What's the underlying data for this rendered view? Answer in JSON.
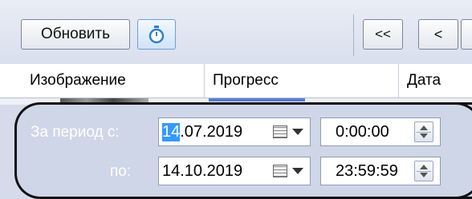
{
  "toolbar": {
    "refresh_label": "Обновить",
    "timer_icon": "stopwatch-icon",
    "first_label": "<<",
    "prev_label": "<"
  },
  "grid": {
    "columns": [
      "Изображение",
      "Прогресс",
      "Дата"
    ]
  },
  "period": {
    "from_label": "За период с:",
    "to_label": "по:",
    "from_date_selected": "14",
    "from_date_rest": ".07.2019",
    "to_date": "14.10.2019",
    "from_time": "0:00:00",
    "to_time": "23:59:59",
    "calendar_icon": "calendar-icon",
    "spin_icon": "spinner-icon"
  },
  "colors": {
    "selection": "#3399ff",
    "panel": "#cfd6e8"
  }
}
